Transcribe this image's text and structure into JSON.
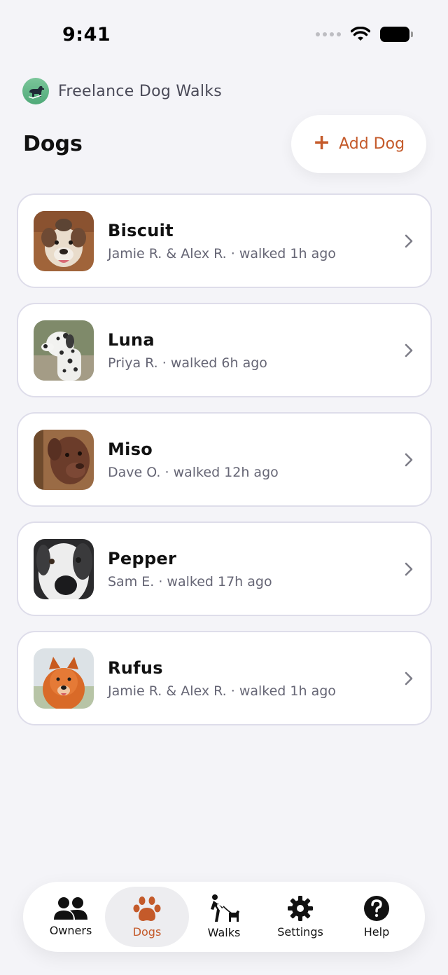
{
  "status_bar": {
    "time": "9:41"
  },
  "app": {
    "brand_name": "Freelance Dog Walks"
  },
  "header": {
    "title": "Dogs",
    "add_button_label": "Add Dog"
  },
  "colors": {
    "accent": "#C45A2A",
    "background": "#F4F4F8",
    "brand_green": "#5DB784"
  },
  "dogs": [
    {
      "name": "Biscuit",
      "subtitle": "Jamie R. & Alex R. · walked 1h ago"
    },
    {
      "name": "Luna",
      "subtitle": "Priya R. · walked 6h ago"
    },
    {
      "name": "Miso",
      "subtitle": "Dave O. · walked 12h ago"
    },
    {
      "name": "Pepper",
      "subtitle": "Sam E. · walked 17h ago"
    },
    {
      "name": "Rufus",
      "subtitle": "Jamie R. & Alex R. · walked 1h ago"
    }
  ],
  "tabs": [
    {
      "label": "Owners",
      "icon": "people-icon",
      "active": false
    },
    {
      "label": "Dogs",
      "icon": "paw-icon",
      "active": true
    },
    {
      "label": "Walks",
      "icon": "walker-icon",
      "active": false
    },
    {
      "label": "Settings",
      "icon": "gear-icon",
      "active": false
    },
    {
      "label": "Help",
      "icon": "help-icon",
      "active": false
    }
  ]
}
